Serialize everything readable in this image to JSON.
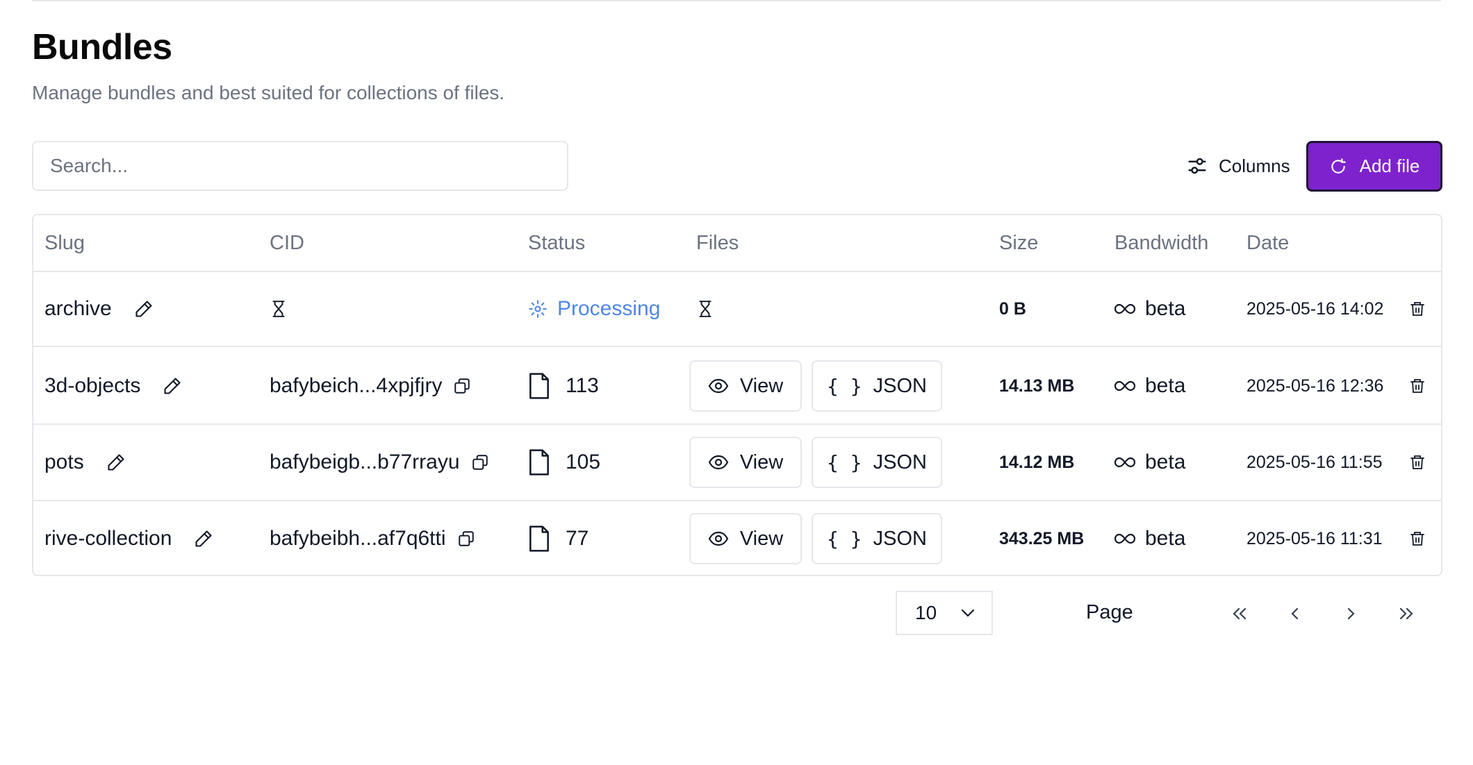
{
  "header": {
    "title": "Bundles",
    "subtitle": "Manage bundles and best suited for collections of files."
  },
  "toolbar": {
    "search_placeholder": "Search...",
    "columns_label": "Columns",
    "add_label": "Add file",
    "accent_color": "#7e22ce"
  },
  "table": {
    "columns": [
      "Slug",
      "CID",
      "Status",
      "Files",
      "Size",
      "Bandwidth",
      "Date"
    ],
    "rows": [
      {
        "slug": "archive",
        "cid": "",
        "cid_icon": "hourglass-icon",
        "status": "Processing",
        "status_icon": "processing-icon",
        "status_color": "#4f86e6",
        "files": "",
        "files_icon": "hourglass-icon",
        "size": "0 B",
        "bandwidth": "beta",
        "date": "2025-05-16 14:02"
      },
      {
        "slug": "3d-objects",
        "cid": "bafybeich...4xpjfjry",
        "status": "113",
        "status_icon": "file-icon",
        "view_label": "View",
        "json_label": "JSON",
        "size": "14.13 MB",
        "bandwidth": "beta",
        "date": "2025-05-16 12:36"
      },
      {
        "slug": "pots",
        "cid": "bafybeigb...b77rrayu",
        "status": "105",
        "status_icon": "file-icon",
        "view_label": "View",
        "json_label": "JSON",
        "size": "14.12 MB",
        "bandwidth": "beta",
        "date": "2025-05-16 11:55"
      },
      {
        "slug": "rive-collection",
        "cid": "bafybeibh...af7q6tti",
        "status": "77",
        "status_icon": "file-icon",
        "view_label": "View",
        "json_label": "JSON",
        "size": "343.25 MB",
        "bandwidth": "beta",
        "date": "2025-05-16 11:31"
      }
    ]
  },
  "pagination": {
    "page_size": "10",
    "page_label": "Page"
  }
}
